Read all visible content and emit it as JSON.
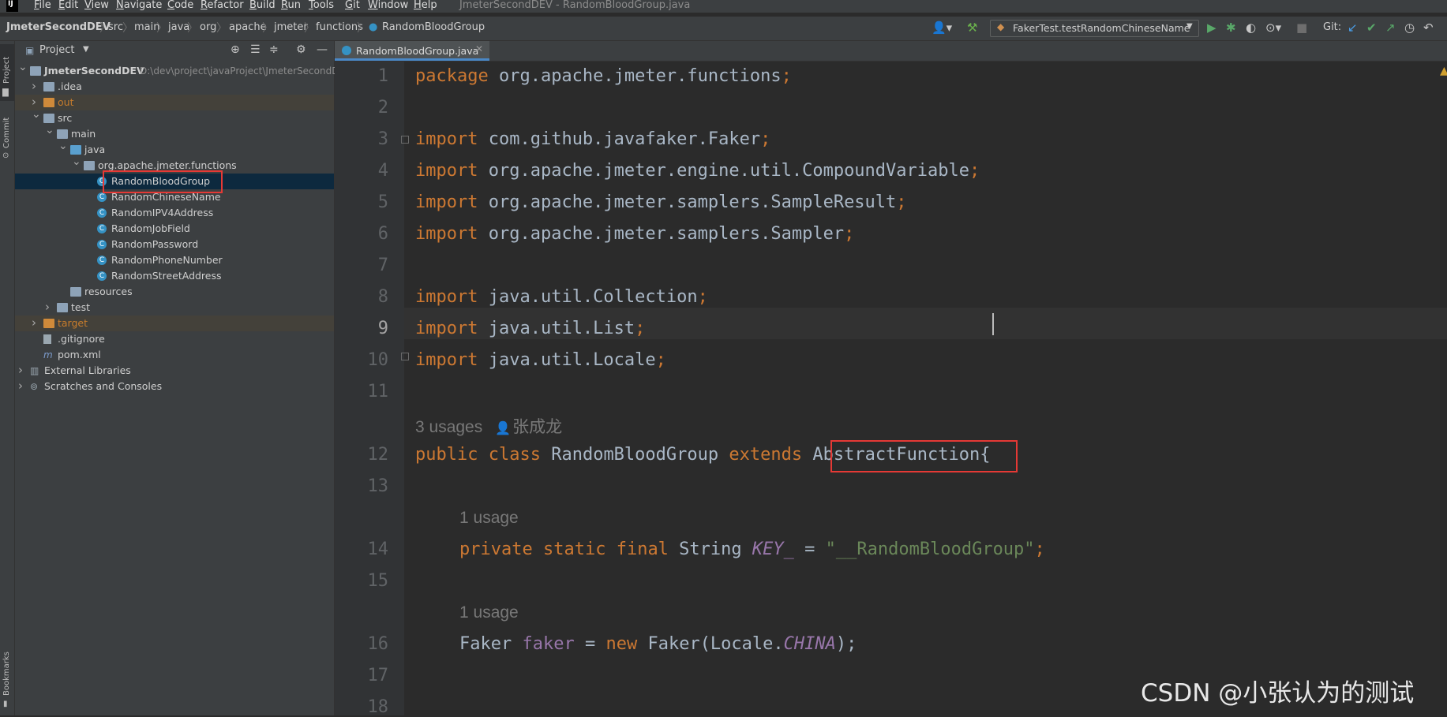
{
  "menubar": {
    "logo": "IJ",
    "items": [
      "File",
      "Edit",
      "View",
      "Navigate",
      "Code",
      "Refactor",
      "Build",
      "Run",
      "Tools",
      "Git",
      "Window",
      "Help"
    ],
    "window_title": "JmeterSecondDEV - RandomBloodGroup.java"
  },
  "breadcrumbs": [
    "JmeterSecondDEV",
    "src",
    "main",
    "java",
    "org",
    "apache",
    "jmeter",
    "functions",
    "RandomBloodGroup"
  ],
  "toolbar": {
    "run_config": "FakerTest.testRandomChineseName",
    "git_label": "Git:"
  },
  "left_strip": {
    "project": "Project",
    "commit": "Commit",
    "bookmarks": "Bookmarks"
  },
  "project_panel": {
    "title": "Project",
    "root_name": "JmeterSecondDEV",
    "root_path": "D:\\dev\\project\\javaProject\\JmeterSecondD",
    "tree": [
      {
        "label": "JmeterSecondDEV",
        "level": 0,
        "arrow": "down",
        "icon": "folder"
      },
      {
        "label": ".idea",
        "level": 1,
        "arrow": "right",
        "icon": "folder"
      },
      {
        "label": "out",
        "level": 1,
        "arrow": "right",
        "icon": "folder-orange"
      },
      {
        "label": "src",
        "level": 1,
        "arrow": "down",
        "icon": "folder"
      },
      {
        "label": "main",
        "level": 2,
        "arrow": "down",
        "icon": "folder"
      },
      {
        "label": "java",
        "level": 3,
        "arrow": "down",
        "icon": "folder-blue"
      },
      {
        "label": "org.apache.jmeter.functions",
        "level": 4,
        "arrow": "down",
        "icon": "package"
      },
      {
        "label": "RandomBloodGroup",
        "level": 5,
        "arrow": "",
        "icon": "class"
      },
      {
        "label": "RandomChineseName",
        "level": 5,
        "arrow": "",
        "icon": "class"
      },
      {
        "label": "RandomIPV4Address",
        "level": 5,
        "arrow": "",
        "icon": "class"
      },
      {
        "label": "RandomJobField",
        "level": 5,
        "arrow": "",
        "icon": "class"
      },
      {
        "label": "RandomPassword",
        "level": 5,
        "arrow": "",
        "icon": "class"
      },
      {
        "label": "RandomPhoneNumber",
        "level": 5,
        "arrow": "",
        "icon": "class"
      },
      {
        "label": "RandomStreetAddress",
        "level": 5,
        "arrow": "",
        "icon": "class"
      },
      {
        "label": "resources",
        "level": 3,
        "arrow": "",
        "icon": "folder"
      },
      {
        "label": "test",
        "level": 2,
        "arrow": "right",
        "icon": "folder"
      },
      {
        "label": "target",
        "level": 1,
        "arrow": "right",
        "icon": "folder-orange"
      },
      {
        "label": ".gitignore",
        "level": 1,
        "arrow": "",
        "icon": "file"
      },
      {
        "label": "pom.xml",
        "level": 1,
        "arrow": "",
        "icon": "maven"
      },
      {
        "label": "External Libraries",
        "level": 0,
        "arrow": "right",
        "icon": "library"
      },
      {
        "label": "Scratches and Consoles",
        "level": 0,
        "arrow": "right",
        "icon": "scratch"
      }
    ],
    "selected": "RandomBloodGroup"
  },
  "editor": {
    "tab_label": "RandomBloodGroup.java",
    "current_line": 9,
    "line_numbers": [
      "1",
      "2",
      "3",
      "4",
      "5",
      "6",
      "7",
      "8",
      "9",
      "10",
      "11",
      "12",
      "13",
      "14",
      "15",
      "16",
      "17",
      "18"
    ],
    "lines": {
      "l1_kw": "package",
      "l1_rest": " org.apache.jmeter.functions",
      "semi": ";",
      "import_kw": "import",
      "l3": " com.github.javafaker.Faker",
      "l4": " org.apache.jmeter.engine.util.CompoundVariable",
      "l5": " org.apache.jmeter.samplers.SampleResult",
      "l6": " org.apache.jmeter.samplers.Sampler",
      "l8": " java.util.Collection",
      "l9": " java.util.List",
      "l10": " java.util.Locale",
      "l12_public": "public",
      "l12_class": "class",
      "l12_name": " RandomBloodGroup ",
      "l12_extends": "extends",
      "l12_super": "AbstractFunction",
      "l12_brace": "{",
      "l14_private": "private",
      "l14_static": "static",
      "l14_final": "final",
      "l14_type": " String ",
      "l14_field": "KEY_",
      "l14_eq": " = ",
      "l14_str": "\"__RandomBloodGroup\"",
      "l16_type": "Faker ",
      "l16_field": "faker",
      "l16_eq": " = ",
      "l16_new": "new",
      "l16_ctor": " Faker(Locale.",
      "l16_const": "CHINA",
      "l16_end": ");"
    },
    "hints": {
      "class_usages": "3 usages",
      "author": "张成龙",
      "usage1": "1 usage",
      "usage2": "1 usage"
    }
  },
  "watermark": "CSDN @小张认为的测试",
  "colors": {
    "keyword": "#cc7832",
    "string": "#6a8759",
    "field": "#9876aa",
    "default": "#a9b7c6",
    "highlight_box": "#e53935"
  }
}
